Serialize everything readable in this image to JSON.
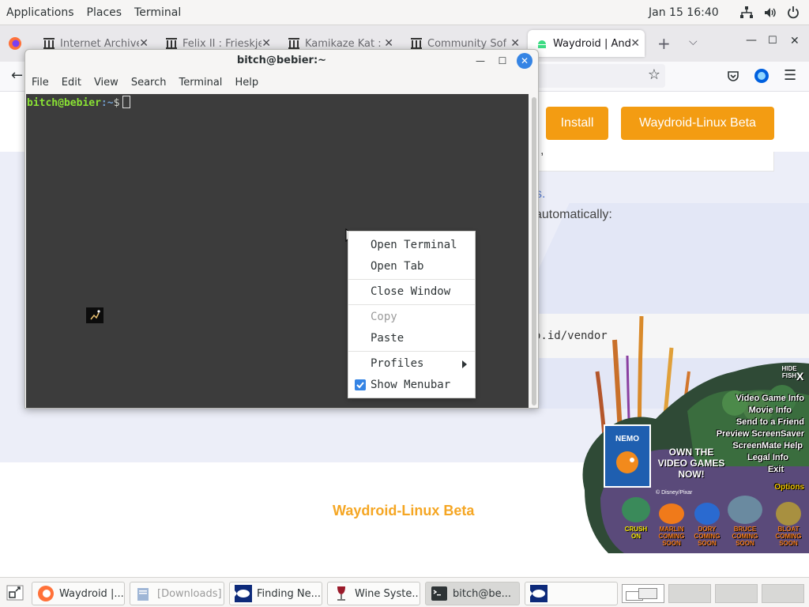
{
  "top_panel": {
    "menus": [
      "Applications",
      "Places",
      "Terminal"
    ],
    "clock": "Jan 15  16:40",
    "tray_icons": [
      "network-icon",
      "volume-icon",
      "power-icon"
    ]
  },
  "browser": {
    "tabs": [
      {
        "label": "Internet Archive",
        "icon": "archive-icon"
      },
      {
        "label": "Felix II : Frieskje",
        "icon": "archive-icon"
      },
      {
        "label": "Kamikaze Kat : I",
        "icon": "archive-icon"
      },
      {
        "label": "Community Soft",
        "icon": "archive-icon"
      },
      {
        "label": "Waydroid | Andr",
        "icon": "android-icon"
      }
    ],
    "page": {
      "buttons": [
        "Install",
        "Waydroid-Linux Beta"
      ],
      "text_fragments": [
        "s.",
        "automatically:",
        ".",
        ","
      ],
      "code_text": "o.id/vendor",
      "footer_link": "Waydroid-Linux Beta"
    }
  },
  "terminal": {
    "title": "bitch@bebier:~",
    "menus": [
      "File",
      "Edit",
      "View",
      "Search",
      "Terminal",
      "Help"
    ],
    "prompt_user": "bitch@bebier",
    "prompt_path": ":~",
    "prompt_symbol": "$"
  },
  "context_menu": {
    "items": [
      {
        "label": "Open Terminal"
      },
      {
        "label": "Open Tab"
      },
      {
        "label": "Close Window"
      },
      {
        "label": "Copy",
        "disabled": true
      },
      {
        "label": "Paste"
      },
      {
        "label": "Profiles",
        "submenu": true
      },
      {
        "label": "Show Menubar",
        "checked": true
      }
    ]
  },
  "screenmate": {
    "hide_label_1": "HIDE",
    "hide_label_2": "FISH",
    "close_label": "X",
    "menu": [
      "Video Game Info",
      "Movie Info",
      "Send to a Friend",
      "Preview ScreenSaver",
      "ScreenMate Help",
      "Legal Info",
      "Exit"
    ],
    "options_label": "Options",
    "promo_line1": "OWN THE",
    "promo_line2": "VIDEO GAMES",
    "promo_line3": "NOW!",
    "box_title": "NEMO",
    "copyright": "© Disney/Pixar",
    "characters": [
      {
        "name": "CRUSH",
        "status": "ON"
      },
      {
        "name": "MARLIN",
        "status": "COMING SOON"
      },
      {
        "name": "DORY",
        "status": "COMING SOON"
      },
      {
        "name": "BRUCE",
        "status": "COMING SOON"
      },
      {
        "name": "BLOAT",
        "status": "COMING SOON"
      }
    ]
  },
  "taskbar": {
    "items": [
      {
        "label": "Waydroid |...",
        "icon": "firefox-icon"
      },
      {
        "label": "[Downloads]",
        "icon": "folder-icon"
      },
      {
        "label": "Finding Ne...",
        "icon": "nemo-icon"
      },
      {
        "label": "Wine Syste...",
        "icon": "wine-icon"
      },
      {
        "label": "bitch@be...",
        "icon": "terminal-icon"
      },
      {
        "label": "",
        "icon": "nemo-icon"
      }
    ]
  },
  "colors": {
    "accent_orange": "#f39c12",
    "terminal_bg": "#3c3c3c",
    "prompt_green": "#8ae234",
    "prompt_blue": "#729fcf",
    "checkbox_blue": "#3584e4"
  }
}
